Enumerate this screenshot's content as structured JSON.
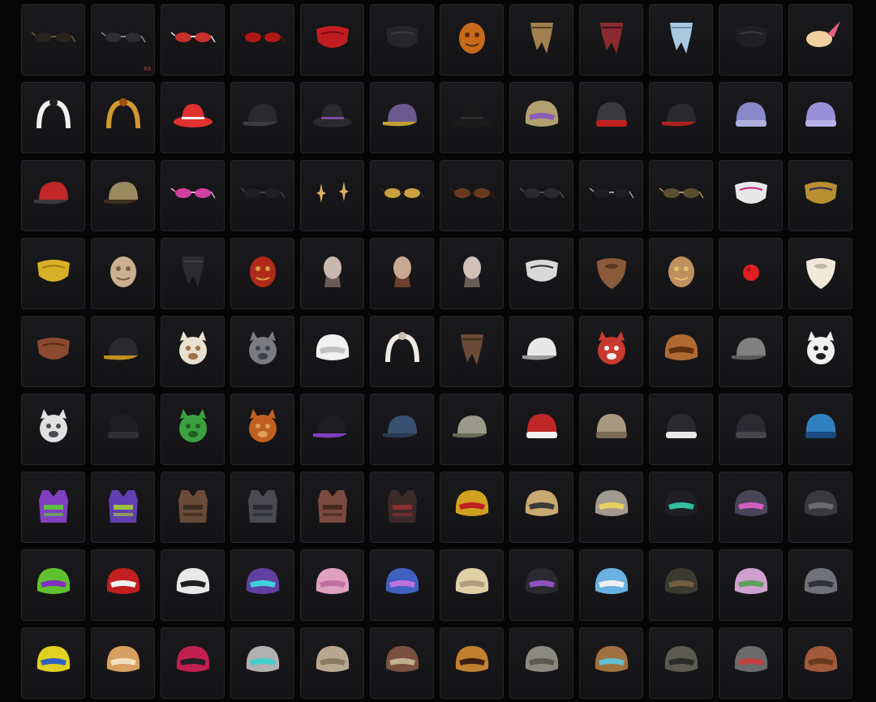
{
  "inventory": {
    "columns": 12,
    "items": [
      {
        "icon": "sunglasses-dark-icon",
        "c1": "#2a2420",
        "c2": "#6b5a40",
        "shape": "glasses"
      },
      {
        "icon": "aviator-glasses-icon",
        "c1": "#2e2e30",
        "c2": "#888888",
        "shape": "glasses",
        "qty": "X3"
      },
      {
        "icon": "red-lens-glasses-icon",
        "c1": "#c8302a",
        "c2": "#e8e8e8",
        "shape": "glasses"
      },
      {
        "icon": "red-glasses-icon",
        "c1": "#b01818",
        "c2": "#551010",
        "shape": "glasses"
      },
      {
        "icon": "red-mask-icon",
        "c1": "#c01c22",
        "c2": "#7a0e12",
        "shape": "mask"
      },
      {
        "icon": "black-mask-icon",
        "c1": "#262628",
        "c2": "#3c3c3e",
        "shape": "mask"
      },
      {
        "icon": "pumpkin-mask-icon",
        "c1": "#c86a1c",
        "c2": "#5a2a08",
        "shape": "round"
      },
      {
        "icon": "feather-headpiece-icon",
        "c1": "#a08050",
        "c2": "#5a4020",
        "shape": "drape"
      },
      {
        "icon": "red-bandana-icon",
        "c1": "#8a2a30",
        "c2": "#3a1418",
        "shape": "drape"
      },
      {
        "icon": "blue-scarf-icon",
        "c1": "#a8c8e0",
        "c2": "#6a90b0",
        "shape": "drape"
      },
      {
        "icon": "black-face-mask-icon",
        "c1": "#202022",
        "c2": "#3a3a3c",
        "shape": "mask"
      },
      {
        "icon": "ice-cream-hat-icon",
        "c1": "#f0d0a0",
        "c2": "#e06080",
        "shape": "cone"
      },
      {
        "icon": "panda-headband-icon",
        "c1": "#f0f0f0",
        "c2": "#202020",
        "shape": "band"
      },
      {
        "icon": "antler-headband-icon",
        "c1": "#d09830",
        "c2": "#a05010",
        "shape": "band"
      },
      {
        "icon": "striped-bucket-hat-icon",
        "c1": "#e03030",
        "c2": "#f4f4f4",
        "shape": "hat"
      },
      {
        "icon": "black-cap-icon",
        "c1": "#2a2a2c",
        "c2": "#3c3c3e",
        "shape": "cap"
      },
      {
        "icon": "cowboy-hat-icon",
        "c1": "#2a2a2c",
        "c2": "#7a4a9a",
        "shape": "hat"
      },
      {
        "icon": "officer-cap-icon",
        "c1": "#6a5a90",
        "c2": "#c0a030",
        "shape": "cap"
      },
      {
        "icon": "pilgrim-hat-icon",
        "c1": "#1a1a1a",
        "c2": "#2a2a2a",
        "shape": "hat"
      },
      {
        "icon": "pith-helmet-icon",
        "c1": "#b0a070",
        "c2": "#8a60b0",
        "shape": "helmet"
      },
      {
        "icon": "headphone-beanie-icon",
        "c1": "#3a3a3c",
        "c2": "#c02020",
        "shape": "beanie"
      },
      {
        "icon": "dark-cap-icon",
        "c1": "#2a2a2c",
        "c2": "#b02020",
        "shape": "cap"
      },
      {
        "icon": "purple-beanie-icon",
        "c1": "#8a88c8",
        "c2": "#b0b0e0",
        "shape": "beanie"
      },
      {
        "icon": "lavender-beanie-icon",
        "c1": "#9a90d8",
        "c2": "#b8b0ea",
        "shape": "beanie"
      },
      {
        "icon": "red-cap-icon",
        "c1": "#c02828",
        "c2": "#3a3a3c",
        "shape": "cap"
      },
      {
        "icon": "military-cap-icon",
        "c1": "#9a8a60",
        "c2": "#3a3020",
        "shape": "cap"
      },
      {
        "icon": "pink-visor-icon",
        "c1": "#d040a0",
        "c2": "#f0a0d0",
        "shape": "glasses"
      },
      {
        "icon": "black-headset-glasses-icon",
        "c1": "#202022",
        "c2": "#404044",
        "shape": "glasses"
      },
      {
        "icon": "star-earrings-icon",
        "c1": "#d8b060",
        "c2": "#806030",
        "shape": "star"
      },
      {
        "icon": "round-gold-glasses-icon",
        "c1": "#c8a040",
        "c2": "#302a20",
        "shape": "glasses"
      },
      {
        "icon": "brown-aviators-icon",
        "c1": "#6a3a20",
        "c2": "#3a2010",
        "shape": "glasses"
      },
      {
        "icon": "dark-goggles-icon",
        "c1": "#2a2a2e",
        "c2": "#4a4a50",
        "shape": "glasses"
      },
      {
        "icon": "black-sunglasses-icon",
        "c1": "#1e1e20",
        "c2": "#9a9a9a",
        "shape": "glasses"
      },
      {
        "icon": "gold-sunglasses-icon",
        "c1": "#5a5030",
        "c2": "#a89060",
        "shape": "glasses"
      },
      {
        "icon": "pattern-face-mask-icon",
        "c1": "#e8e8e8",
        "c2": "#c02080",
        "shape": "mask"
      },
      {
        "icon": "ornate-masquerade-icon",
        "c1": "#b89030",
        "c2": "#2a2a60",
        "shape": "mask"
      },
      {
        "icon": "gold-mask-icon",
        "c1": "#d8b028",
        "c2": "#a07a10",
        "shape": "mask"
      },
      {
        "icon": "voodoo-mask-icon",
        "c1": "#c8b090",
        "c2": "#806040",
        "shape": "round"
      },
      {
        "icon": "black-scarf-icon",
        "c1": "#2a2a30",
        "c2": "#404048",
        "shape": "drape"
      },
      {
        "icon": "oni-mask-icon",
        "c1": "#b02a1c",
        "c2": "#d8a040",
        "shape": "round"
      },
      {
        "icon": "bald-head-icon",
        "c1": "#c8b8b0",
        "c2": "#6a5a58",
        "shape": "head"
      },
      {
        "icon": "bearded-head-icon",
        "c1": "#c8a890",
        "c2": "#6a4030",
        "shape": "head"
      },
      {
        "icon": "stubble-head-icon",
        "c1": "#d0c0b8",
        "c2": "#6a5a58",
        "shape": "head"
      },
      {
        "icon": "fanged-mask-icon",
        "c1": "#d8d8d8",
        "c2": "#2a2a2a",
        "shape": "mask"
      },
      {
        "icon": "brown-beard-icon",
        "c1": "#8a5a3a",
        "c2": "#5a3a20",
        "shape": "beard"
      },
      {
        "icon": "gas-mask-icon",
        "c1": "#c09060",
        "c2": "#e0c070",
        "shape": "round"
      },
      {
        "icon": "clown-nose-icon",
        "c1": "#e02020",
        "c2": "#901010",
        "shape": "dot"
      },
      {
        "icon": "white-beard-icon",
        "c1": "#f0e8d8",
        "c2": "#c0b8a8",
        "shape": "beard"
      },
      {
        "icon": "beast-jaw-icon",
        "c1": "#8a4a30",
        "c2": "#5a2a18",
        "shape": "mask"
      },
      {
        "icon": "emblem-cap-icon",
        "c1": "#2a2a2c",
        "c2": "#c09020",
        "shape": "cap"
      },
      {
        "icon": "reindeer-mask-icon",
        "c1": "#e8e0d0",
        "c2": "#a07040",
        "shape": "animal"
      },
      {
        "icon": "wolf-mask-icon",
        "c1": "#7a7a80",
        "c2": "#40404a",
        "shape": "animal"
      },
      {
        "icon": "white-robot-helmet-icon",
        "c1": "#f0f0f0",
        "c2": "#c0c0c0",
        "shape": "helmet"
      },
      {
        "icon": "fur-headband-icon",
        "c1": "#f0ece4",
        "c2": "#c8c0b4",
        "shape": "band"
      },
      {
        "icon": "brown-wrap-icon",
        "c1": "#6a4a38",
        "c2": "#3a2a20",
        "shape": "drape"
      },
      {
        "icon": "white-cap-icon",
        "c1": "#e8e8e8",
        "c2": "#9a9a9a",
        "shape": "cap"
      },
      {
        "icon": "sausage-mascot-icon",
        "c1": "#c83a30",
        "c2": "#f0f0f0",
        "shape": "animal"
      },
      {
        "icon": "diving-helmet-icon",
        "c1": "#b06a30",
        "c2": "#603010",
        "shape": "helmet"
      },
      {
        "icon": "grey-cap-icon",
        "c1": "#808080",
        "c2": "#5a5a5a",
        "shape": "cap"
      },
      {
        "icon": "sheep-hat-icon",
        "c1": "#f0f0f0",
        "c2": "#202020",
        "shape": "animal"
      },
      {
        "icon": "husky-mask-icon",
        "c1": "#e0e0e0",
        "c2": "#4a4a50",
        "shape": "animal"
      },
      {
        "icon": "black-beanie-icon",
        "c1": "#1e1e20",
        "c2": "#303032",
        "shape": "beanie"
      },
      {
        "icon": "dino-mask-icon",
        "c1": "#3aa040",
        "c2": "#1e6020",
        "shape": "animal"
      },
      {
        "icon": "lion-mask-icon",
        "c1": "#c06020",
        "c2": "#e0a050",
        "shape": "animal"
      },
      {
        "icon": "purple-trim-cap-icon",
        "c1": "#1e1e22",
        "c2": "#8040c0",
        "shape": "cap"
      },
      {
        "icon": "denim-cap-icon",
        "c1": "#3a5070",
        "c2": "#2a3a50",
        "shape": "cap"
      },
      {
        "icon": "khaki-cap-icon",
        "c1": "#9a9a8a",
        "c2": "#6a6a5a",
        "shape": "cap"
      },
      {
        "icon": "reindeer-beanie-icon",
        "c1": "#c02828",
        "c2": "#f0f0f0",
        "shape": "beanie"
      },
      {
        "icon": "fur-ushanka-icon",
        "c1": "#a89880",
        "c2": "#7a6a58",
        "shape": "beanie"
      },
      {
        "icon": "trapper-hat-icon",
        "c1": "#2a2a2c",
        "c2": "#e8e8e8",
        "shape": "beanie"
      },
      {
        "icon": "black-fur-hat-icon",
        "c1": "#2a2a30",
        "c2": "#44444a",
        "shape": "beanie"
      },
      {
        "icon": "blue-bandana-cap-icon",
        "c1": "#3080c0",
        "c2": "#1a4a80",
        "shape": "beanie"
      },
      {
        "icon": "graffiti-vest-icon",
        "c1": "#8040c0",
        "c2": "#60c040",
        "shape": "vest"
      },
      {
        "icon": "purple-vest-icon",
        "c1": "#6040b0",
        "c2": "#a0c040",
        "shape": "vest"
      },
      {
        "icon": "brown-vest-icon",
        "c1": "#6a4a38",
        "c2": "#3a2a20",
        "shape": "vest"
      },
      {
        "icon": "grey-vest-icon",
        "c1": "#4a4a50",
        "c2": "#2a2a30",
        "shape": "vest"
      },
      {
        "icon": "leather-vest-icon",
        "c1": "#7a4a40",
        "c2": "#4a2a20",
        "shape": "vest"
      },
      {
        "icon": "dark-red-vest-icon",
        "c1": "#3a2a2a",
        "c2": "#8a3030",
        "shape": "vest"
      },
      {
        "icon": "tiger-helmet-icon",
        "c1": "#d0a020",
        "c2": "#c02020",
        "shape": "helmet"
      },
      {
        "icon": "tan-level3-helmet-icon",
        "c1": "#c8a870",
        "c2": "#3a3a3a",
        "shape": "helmet"
      },
      {
        "icon": "star-helmet-icon",
        "c1": "#a09a90",
        "c2": "#e8d060",
        "shape": "helmet"
      },
      {
        "icon": "black-moto-helmet-icon",
        "c1": "#202024",
        "c2": "#30c0a0",
        "shape": "helmet"
      },
      {
        "icon": "horned-pink-helmet-icon",
        "c1": "#4a4458",
        "c2": "#d060c0",
        "shape": "helmet"
      },
      {
        "icon": "horned-dark-helmet-icon",
        "c1": "#3a3a3e",
        "c2": "#6a6a70",
        "shape": "helmet"
      },
      {
        "icon": "neon-graffiti-helmet-icon",
        "c1": "#60c030",
        "c2": "#8030c0",
        "shape": "helmet"
      },
      {
        "icon": "santa-helmet-icon",
        "c1": "#c02020",
        "c2": "#f0f0f0",
        "shape": "helmet"
      },
      {
        "icon": "tiger-stripe-helmet-icon",
        "c1": "#e8e8e8",
        "c2": "#202020",
        "shape": "helmet"
      },
      {
        "icon": "cat-ear-helmet-icon",
        "c1": "#6040a0",
        "c2": "#40d0e0",
        "shape": "helmet"
      },
      {
        "icon": "pink-bear-helmet-icon",
        "c1": "#e0a0c0",
        "c2": "#c070a0",
        "shape": "helmet"
      },
      {
        "icon": "galaxy-helmet-icon",
        "c1": "#4060c0",
        "c2": "#c070e0",
        "shape": "helmet"
      },
      {
        "icon": "tan-helmet-icon",
        "c1": "#e0d0a8",
        "c2": "#b0a080",
        "shape": "helmet"
      },
      {
        "icon": "purple-splash-helmet-icon",
        "c1": "#2a2a30",
        "c2": "#9050c0",
        "shape": "helmet"
      },
      {
        "icon": "blue-cartoon-helmet-icon",
        "c1": "#6ab0e0",
        "c2": "#f0f0f0",
        "shape": "helmet"
      },
      {
        "icon": "pilot-helmet-icon",
        "c1": "#3a3a30",
        "c2": "#706040",
        "shape": "helmet"
      },
      {
        "icon": "floral-helmet-icon",
        "c1": "#d0a0d0",
        "c2": "#60a060",
        "shape": "helmet"
      },
      {
        "icon": "grey-visor-helmet-icon",
        "c1": "#707078",
        "c2": "#303038",
        "shape": "helmet"
      },
      {
        "icon": "motocross-helmet-icon",
        "c1": "#e0d020",
        "c2": "#3060c0",
        "shape": "helmet"
      },
      {
        "icon": "shiba-helmet-icon",
        "c1": "#d8a060",
        "c2": "#f0e0c0",
        "shape": "helmet"
      },
      {
        "icon": "red-racing-helmet-icon",
        "c1": "#c02050",
        "c2": "#202024",
        "shape": "helmet"
      },
      {
        "icon": "bear-ear-helmet-icon",
        "c1": "#b0b0b0",
        "c2": "#40d0d0",
        "shape": "helmet"
      },
      {
        "icon": "camo-helmet-icon",
        "c1": "#b8a890",
        "c2": "#8a7a60",
        "shape": "helmet"
      },
      {
        "icon": "viking-helmet-icon",
        "c1": "#7a5040",
        "c2": "#c0b090",
        "shape": "helmet"
      },
      {
        "icon": "leopard-helmet-icon",
        "c1": "#c08030",
        "c2": "#3a2010",
        "shape": "helmet"
      },
      {
        "icon": "worn-level2-helmet-icon",
        "c1": "#8a8a80",
        "c2": "#5a5a50",
        "shape": "helmet"
      },
      {
        "icon": "goggle-helmet-icon",
        "c1": "#a07040",
        "c2": "#60c0d0",
        "shape": "helmet"
      },
      {
        "icon": "spetsnaz-helmet-icon",
        "c1": "#5a5a50",
        "c2": "#2a2a28",
        "shape": "helmet"
      },
      {
        "icon": "grey-helmet-icon",
        "c1": "#6a6a6a",
        "c2": "#c04040",
        "shape": "helmet"
      },
      {
        "icon": "rust-helmet-icon",
        "c1": "#a05a3a",
        "c2": "#6a3a20",
        "shape": "helmet"
      }
    ]
  }
}
